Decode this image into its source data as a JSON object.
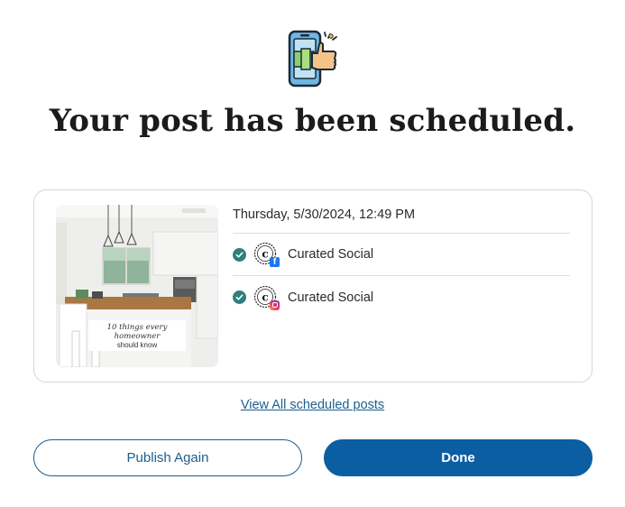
{
  "dialog": {
    "title": "Your post has been scheduled."
  },
  "post": {
    "scheduled_time": "Thursday, 5/30/2024, 12:49 PM",
    "image_caption_script": "10 things every homeowner",
    "image_caption_sub": "should know",
    "accounts": [
      {
        "name": "Curated Social",
        "network": "facebook",
        "status": "scheduled"
      },
      {
        "name": "Curated Social",
        "network": "instagram",
        "status": "scheduled"
      }
    ]
  },
  "links": {
    "view_all": "View All scheduled posts"
  },
  "buttons": {
    "publish_again": "Publish Again",
    "done": "Done"
  },
  "colors": {
    "primary": "#0c5ea3",
    "link": "#1c5e8f",
    "check": "#2f7f7a",
    "facebook": "#1877f2",
    "instagram": "#e1306c"
  },
  "icons": {
    "hero": "phone-thumbs-up-icon",
    "check": "check-circle-icon",
    "avatar": "curated-social-logo"
  }
}
